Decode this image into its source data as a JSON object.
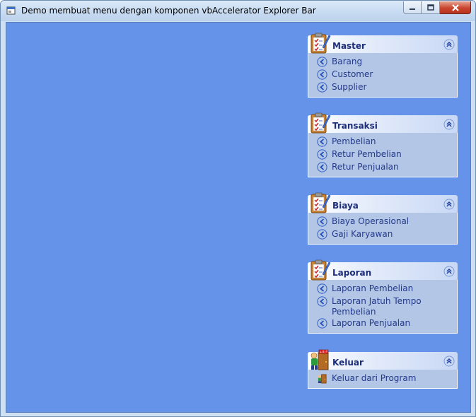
{
  "window": {
    "title": "Demo membuat menu dengan komponen vbAccelerator Explorer Bar"
  },
  "groups": [
    {
      "title": "Master",
      "icon": "clipboard-icon",
      "items": [
        {
          "label": "Barang",
          "icon": "arrow-left-circle-icon"
        },
        {
          "label": "Customer",
          "icon": "arrow-left-circle-icon"
        },
        {
          "label": "Supplier",
          "icon": "arrow-left-circle-icon"
        }
      ]
    },
    {
      "title": "Transaksi",
      "icon": "clipboard-icon",
      "items": [
        {
          "label": "Pembelian",
          "icon": "arrow-left-circle-icon"
        },
        {
          "label": "Retur Pembelian",
          "icon": "arrow-left-circle-icon"
        },
        {
          "label": "Retur Penjualan",
          "icon": "arrow-left-circle-icon"
        }
      ]
    },
    {
      "title": "Biaya",
      "icon": "clipboard-icon",
      "items": [
        {
          "label": "Biaya Operasional",
          "icon": "arrow-left-circle-icon"
        },
        {
          "label": "Gaji Karyawan",
          "icon": "arrow-left-circle-icon"
        }
      ]
    },
    {
      "title": "Laporan",
      "icon": "clipboard-icon",
      "items": [
        {
          "label": "Laporan Pembelian",
          "icon": "arrow-left-circle-icon"
        },
        {
          "label": "Laporan Jatuh Tempo Pembelian",
          "icon": "arrow-left-circle-icon"
        },
        {
          "label": "Laporan Penjualan",
          "icon": "arrow-left-circle-icon"
        }
      ]
    },
    {
      "title": "Keluar",
      "icon": "exit-door-icon",
      "items": [
        {
          "label": "Keluar dari Program",
          "icon": "exit-door-small-icon"
        }
      ]
    }
  ],
  "colors": {
    "client_background": "#6593e9",
    "group_body": "#b3c6e6",
    "link_text": "#243a8a",
    "header_text": "#1c2d7a"
  }
}
